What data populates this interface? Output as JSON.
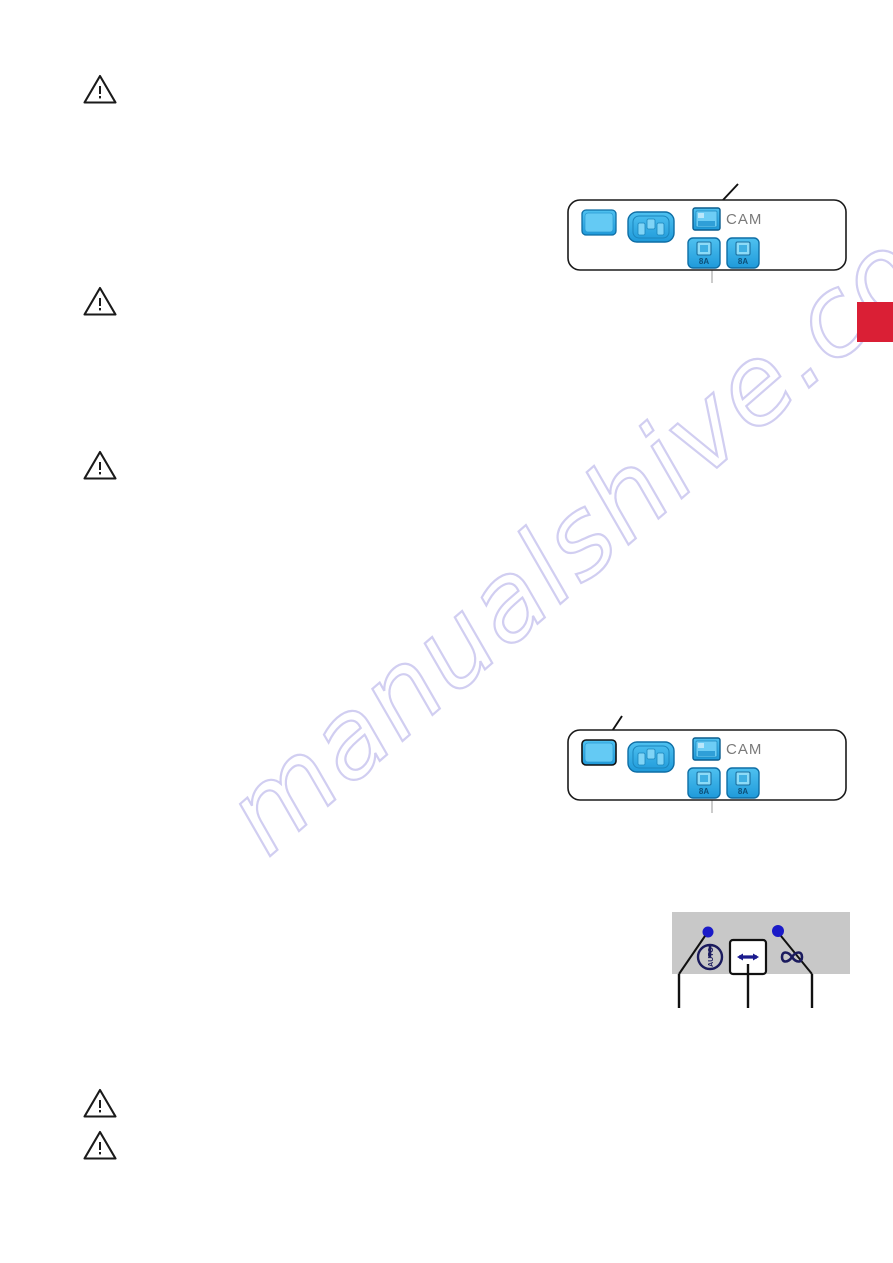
{
  "document": {
    "type": "scanned-manual-page",
    "page_background": "#ffffff",
    "watermark_text": "manualshive.com",
    "watermark_color": "#c9c6ef"
  },
  "page_tab": {
    "name": "red-section-tab",
    "color": "#da1f35",
    "label": ""
  },
  "warnings": [
    {
      "id": "warning-1",
      "symbol": "!",
      "label": ""
    },
    {
      "id": "warning-2",
      "symbol": "!",
      "label": ""
    },
    {
      "id": "warning-3",
      "symbol": "!",
      "label": ""
    },
    {
      "id": "warning-4",
      "symbol": "!",
      "label": ""
    },
    {
      "id": "warning-5",
      "symbol": "!",
      "label": ""
    }
  ],
  "figures": {
    "rear_panel_top": {
      "caption": "",
      "outline_color": "#1a1a1a",
      "component_color": "#35a8e8",
      "callout_target": "camera-port",
      "components": {
        "display_window": {
          "label": ""
        },
        "power_inlet": {
          "label": ""
        },
        "camera_port": {
          "label": "CAM"
        },
        "fuse_left": {
          "label": "8A"
        },
        "fuse_right": {
          "label": "8A"
        }
      }
    },
    "rear_panel_bottom": {
      "caption": "",
      "outline_color": "#1a1a1a",
      "component_color": "#35a8e8",
      "callout_target": "display-window",
      "components": {
        "display_window": {
          "label": ""
        },
        "power_inlet": {
          "label": ""
        },
        "camera_port": {
          "label": "CAM"
        },
        "fuse_left": {
          "label": "8A"
        },
        "fuse_right": {
          "label": "8A"
        }
      }
    },
    "control_panel": {
      "caption": "",
      "background_color": "#c8c8c8",
      "led_color": "#1a1ac8",
      "icon_color": "#1b1b5e",
      "buttons": [
        {
          "id": "standby-auto-button",
          "icon": "power-auto-icon",
          "label": "AUTO",
          "has_led": true
        },
        {
          "id": "bidirectional-button",
          "icon": "double-arrow-icon",
          "label": "",
          "has_led": false,
          "boxed": true
        },
        {
          "id": "continuous-button",
          "icon": "infinity-icon",
          "label": "",
          "has_led": true
        }
      ]
    }
  }
}
